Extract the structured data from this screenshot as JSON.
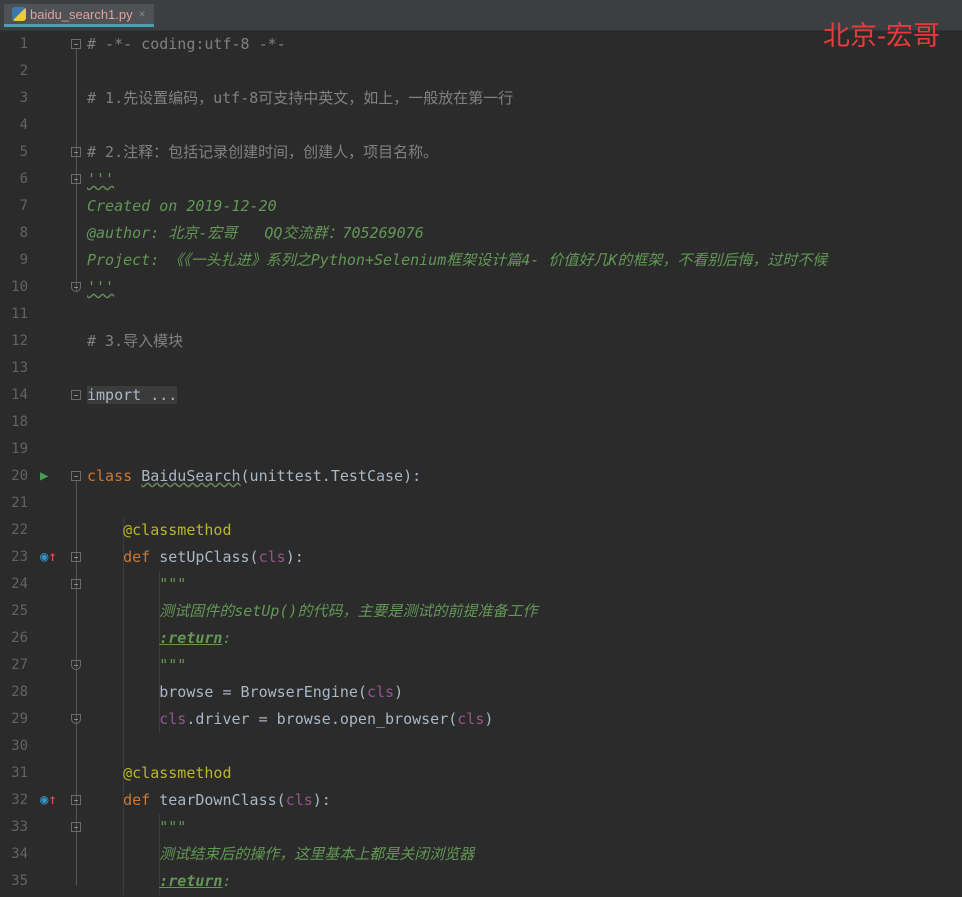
{
  "tab": {
    "filename": "baidu_search1.py",
    "close": "×",
    "icon": "python-file-icon"
  },
  "watermark": "北京-宏哥",
  "colors": {
    "background": "#2b2b2b",
    "comment": "#808080",
    "docstring": "#629755",
    "keyword": "#cc7832",
    "decorator": "#bbb529",
    "self": "#94558d",
    "watermark": "#e83a3a"
  },
  "lines": [
    {
      "n": "1",
      "fold": "start",
      "tokens": [
        [
          "# -*- coding:utf-8 -*-",
          "com"
        ]
      ]
    },
    {
      "n": "2",
      "tokens": []
    },
    {
      "n": "3",
      "tokens": [
        [
          "# 1.先设置编码，utf-8可支持中英文，如上，一般放在第一行",
          "com"
        ]
      ]
    },
    {
      "n": "4",
      "tokens": []
    },
    {
      "n": "5",
      "fold": "start",
      "tokens": [
        [
          "# 2.注释：包括记录创建时间，创建人，项目名称。",
          "com"
        ]
      ]
    },
    {
      "n": "6",
      "fold": "start",
      "tokens": [
        [
          "'''",
          "doc wavy"
        ]
      ]
    },
    {
      "n": "7",
      "tokens": [
        [
          "Created on 2019-12-20",
          "doc"
        ]
      ]
    },
    {
      "n": "8",
      "tokens": [
        [
          "@author: 北京-宏哥   QQ交流群：705269076",
          "doc"
        ]
      ]
    },
    {
      "n": "9",
      "tokens": [
        [
          "Project: 《《一头扎进》系列之Python+Selenium框架设计篇4- 价值好几K的框架，不看别后悔，过时不候",
          "doc"
        ]
      ]
    },
    {
      "n": "10",
      "fold": "end",
      "tokens": [
        [
          "'''",
          "doc wavy"
        ]
      ]
    },
    {
      "n": "11",
      "tokens": []
    },
    {
      "n": "12",
      "tokens": [
        [
          "# 3.导入模块",
          "com"
        ]
      ]
    },
    {
      "n": "13",
      "tokens": []
    },
    {
      "n": "14",
      "fold": "plus",
      "tokens": [
        [
          "import ...",
          "fold"
        ]
      ]
    },
    {
      "n": "18",
      "tokens": []
    },
    {
      "n": "19",
      "tokens": []
    },
    {
      "n": "20",
      "fold": "start",
      "icon": "run",
      "tokens": [
        [
          "class ",
          "kw"
        ],
        [
          "BaiduSearch",
          "wavy"
        ],
        [
          "(unittest.TestCase):",
          ""
        ]
      ]
    },
    {
      "n": "21",
      "tokens": []
    },
    {
      "n": "22",
      "tokens": [
        [
          "    ",
          ""
        ],
        [
          "@classmethod",
          "dec"
        ]
      ]
    },
    {
      "n": "23",
      "fold": "start",
      "icon": "override",
      "tokens": [
        [
          "    ",
          ""
        ],
        [
          "def ",
          "kw"
        ],
        [
          "setUpClass(",
          ""
        ],
        [
          "cls",
          "self"
        ],
        [
          "):",
          ""
        ]
      ]
    },
    {
      "n": "24",
      "fold": "start",
      "tokens": [
        [
          "        ",
          ""
        ],
        [
          "\"\"\"",
          "doc"
        ]
      ]
    },
    {
      "n": "25",
      "tokens": [
        [
          "        ",
          ""
        ],
        [
          "测试固件的setUp()的代码，主要是测试的前提准备工作",
          "doc"
        ]
      ]
    },
    {
      "n": "26",
      "tokens": [
        [
          "        ",
          ""
        ],
        [
          ":return",
          "tag"
        ],
        [
          ":",
          "doc"
        ]
      ]
    },
    {
      "n": "27",
      "fold": "end",
      "tokens": [
        [
          "        ",
          ""
        ],
        [
          "\"\"\"",
          "doc"
        ]
      ]
    },
    {
      "n": "28",
      "tokens": [
        [
          "        browse = BrowserEngine(",
          ""
        ],
        [
          "cls",
          "self"
        ],
        [
          ")",
          ""
        ]
      ]
    },
    {
      "n": "29",
      "fold": "end",
      "tokens": [
        [
          "        ",
          ""
        ],
        [
          "cls",
          "self"
        ],
        [
          ".driver = browse.open_browser(",
          ""
        ],
        [
          "cls",
          "self"
        ],
        [
          ")",
          ""
        ]
      ]
    },
    {
      "n": "30",
      "tokens": []
    },
    {
      "n": "31",
      "tokens": [
        [
          "    ",
          ""
        ],
        [
          "@classmethod",
          "dec"
        ]
      ]
    },
    {
      "n": "32",
      "fold": "start",
      "icon": "override",
      "tokens": [
        [
          "    ",
          ""
        ],
        [
          "def ",
          "kw"
        ],
        [
          "tearDownClass(",
          ""
        ],
        [
          "cls",
          "self"
        ],
        [
          "):",
          ""
        ]
      ]
    },
    {
      "n": "33",
      "fold": "start",
      "tokens": [
        [
          "        ",
          ""
        ],
        [
          "\"\"\"",
          "doc"
        ]
      ]
    },
    {
      "n": "34",
      "tokens": [
        [
          "        ",
          ""
        ],
        [
          "测试结束后的操作，这里基本上都是关闭浏览器",
          "doc"
        ]
      ]
    },
    {
      "n": "35",
      "tokens": [
        [
          "        ",
          ""
        ],
        [
          ":return",
          "tag"
        ],
        [
          ":",
          "doc"
        ]
      ]
    }
  ]
}
